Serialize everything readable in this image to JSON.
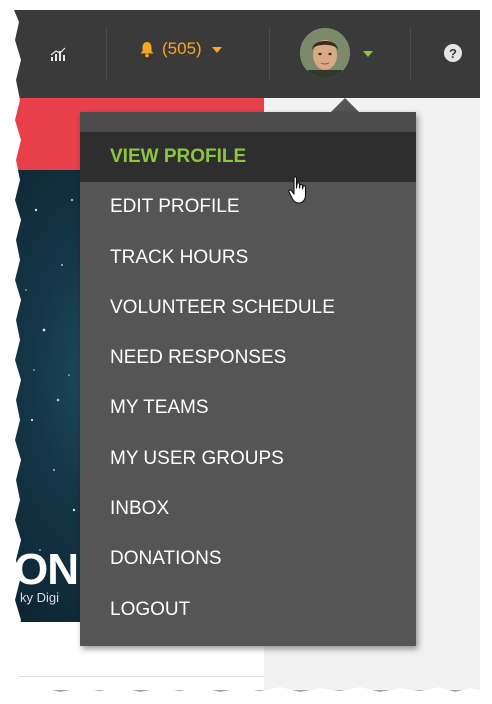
{
  "topbar": {
    "stats_icon": "bar-chart-icon",
    "notifications": {
      "icon": "bell-icon",
      "count": "(505)",
      "color": "#f5a623"
    },
    "profile_caret_color": "#8cc63f",
    "help_icon": "question-circle-icon",
    "help_glyph": "?"
  },
  "hero": {
    "title": "ON",
    "subtitle": "ky Digi"
  },
  "menu": {
    "active_color": "#8cc63f",
    "items": [
      {
        "label": "VIEW PROFILE",
        "active": true
      },
      {
        "label": "EDIT PROFILE"
      },
      {
        "label": "TRACK HOURS"
      },
      {
        "label": "VOLUNTEER SCHEDULE"
      },
      {
        "label": "NEED RESPONSES"
      },
      {
        "label": "MY TEAMS"
      },
      {
        "label": "MY USER GROUPS"
      },
      {
        "label": "INBOX"
      },
      {
        "label": "DONATIONS"
      },
      {
        "label": "LOGOUT"
      }
    ]
  },
  "accent_red": "#e8404a"
}
